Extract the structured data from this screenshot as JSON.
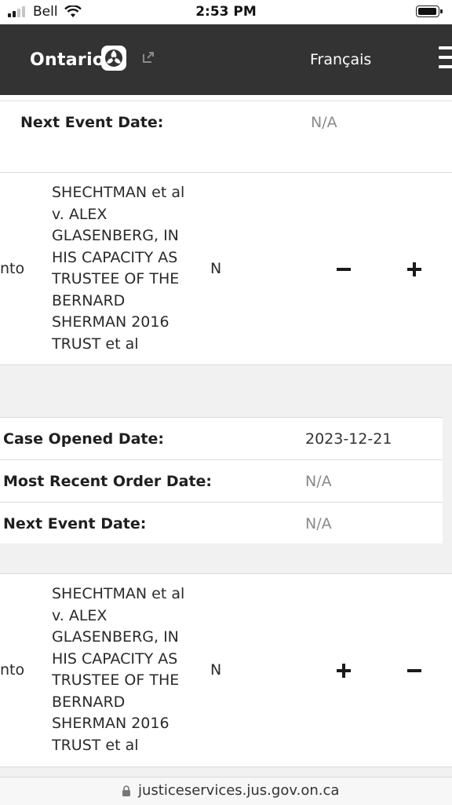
{
  "status_bar": {
    "carrier": "Bell",
    "time": "2:53 PM"
  },
  "header": {
    "logo_text": "Ontario",
    "language_link": "Français"
  },
  "top_details": {
    "next_event_label": "Next Event Date:",
    "next_event_value": "N/A"
  },
  "rows": [
    {
      "location_fragment": "nto",
      "case_name": "SHECHTMAN et al v. ALEX GLASENBERG, IN HIS CAPACITY AS TRUSTEE OF THE BERNARD SHERMAN 2016 TRUST et al",
      "flag": "N",
      "toggle_left": "−",
      "toggle_right": "+"
    },
    {
      "location_fragment": "nto",
      "case_name": "SHECHTMAN et al v. ALEX GLASENBERG, IN HIS CAPACITY AS TRUSTEE OF THE BERNARD SHERMAN 2016 TRUST et al",
      "flag": "N",
      "toggle_left": "+",
      "toggle_right": "−"
    }
  ],
  "expanded_details": {
    "case_opened_label": "Case Opened Date:",
    "case_opened_value": "2023-12-21",
    "recent_order_label": "Most Recent Order Date:",
    "recent_order_value": "N/A",
    "next_event_label": "Next Event Date:",
    "next_event_value": "N/A"
  },
  "url_bar": {
    "url": "justiceservices.jus.gov.on.ca"
  },
  "colors": {
    "header_bg": "#333333",
    "page_bg": "#f1f1f1",
    "muted_value": "#8a8a8a"
  }
}
